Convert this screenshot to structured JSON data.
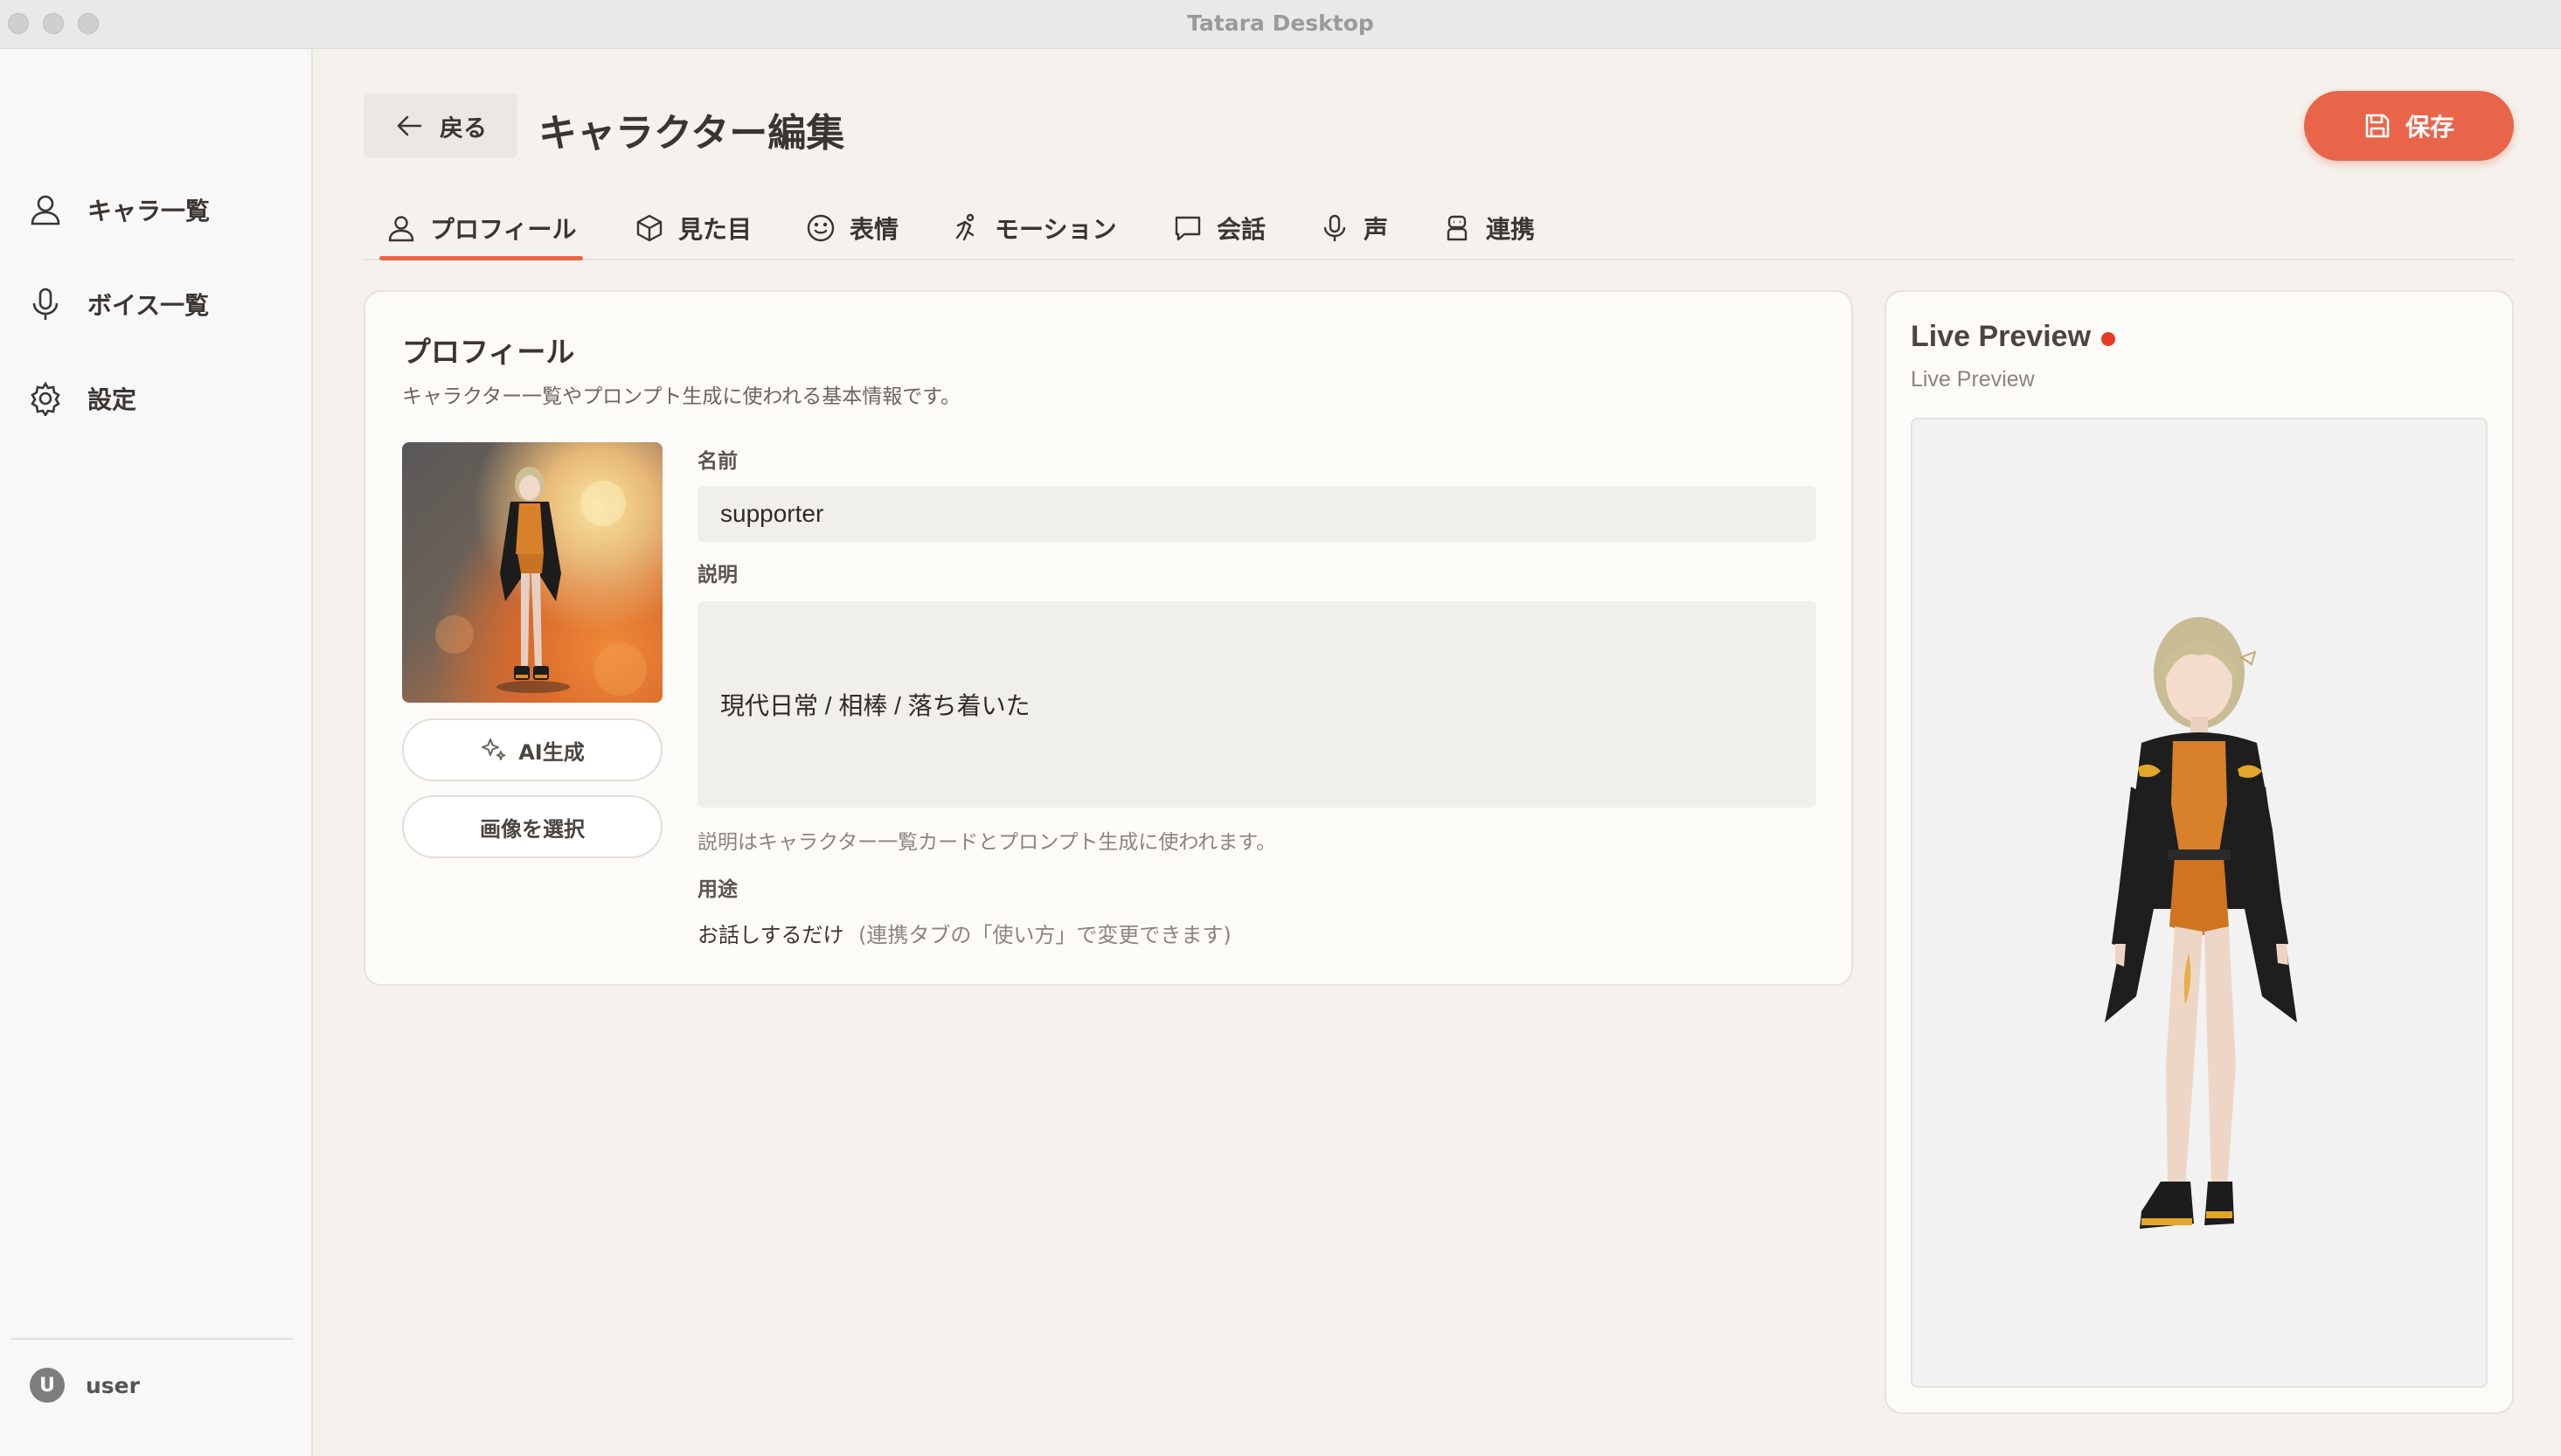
{
  "window": {
    "title": "Tatara Desktop"
  },
  "sidebar": {
    "items": [
      {
        "label": "キャラ一覧",
        "icon": "user-icon"
      },
      {
        "label": "ボイス一覧",
        "icon": "microphone-icon"
      },
      {
        "label": "設定",
        "icon": "gear-icon"
      }
    ],
    "user": {
      "initial": "U",
      "name": "user"
    }
  },
  "header": {
    "back_label": "戻る",
    "title": "キャラクター編集",
    "save_label": "保存"
  },
  "tabs": [
    {
      "label": "プロフィール",
      "icon": "user-icon",
      "active": true
    },
    {
      "label": "見た目",
      "icon": "cube-icon"
    },
    {
      "label": "表情",
      "icon": "smile-icon"
    },
    {
      "label": "モーション",
      "icon": "motion-icon"
    },
    {
      "label": "会話",
      "icon": "chat-bubble-icon"
    },
    {
      "label": "声",
      "icon": "microphone-icon"
    },
    {
      "label": "連携",
      "icon": "robot-icon"
    }
  ],
  "profile": {
    "title": "プロフィール",
    "description": "キャラクター一覧やプロンプト生成に使われる基本情報です。",
    "ai_button": "AI生成",
    "select_image_button": "画像を選択",
    "name_label": "名前",
    "name_value": "supporter",
    "desc_label": "説明",
    "desc_value": "現代日常 / 相棒 / 落ち着いた",
    "desc_hint": "説明はキャラクター一覧カードとプロンプト生成に使われます。",
    "usage_label": "用途",
    "usage_value": "お話しするだけ",
    "usage_note": "(連携タブの「使い方」で変更できます)"
  },
  "preview": {
    "title": "Live Preview",
    "subtitle": "Live Preview"
  },
  "colors": {
    "accent": "#e8654a",
    "live_dot": "#e83a22",
    "background": "#f5f2ed"
  }
}
